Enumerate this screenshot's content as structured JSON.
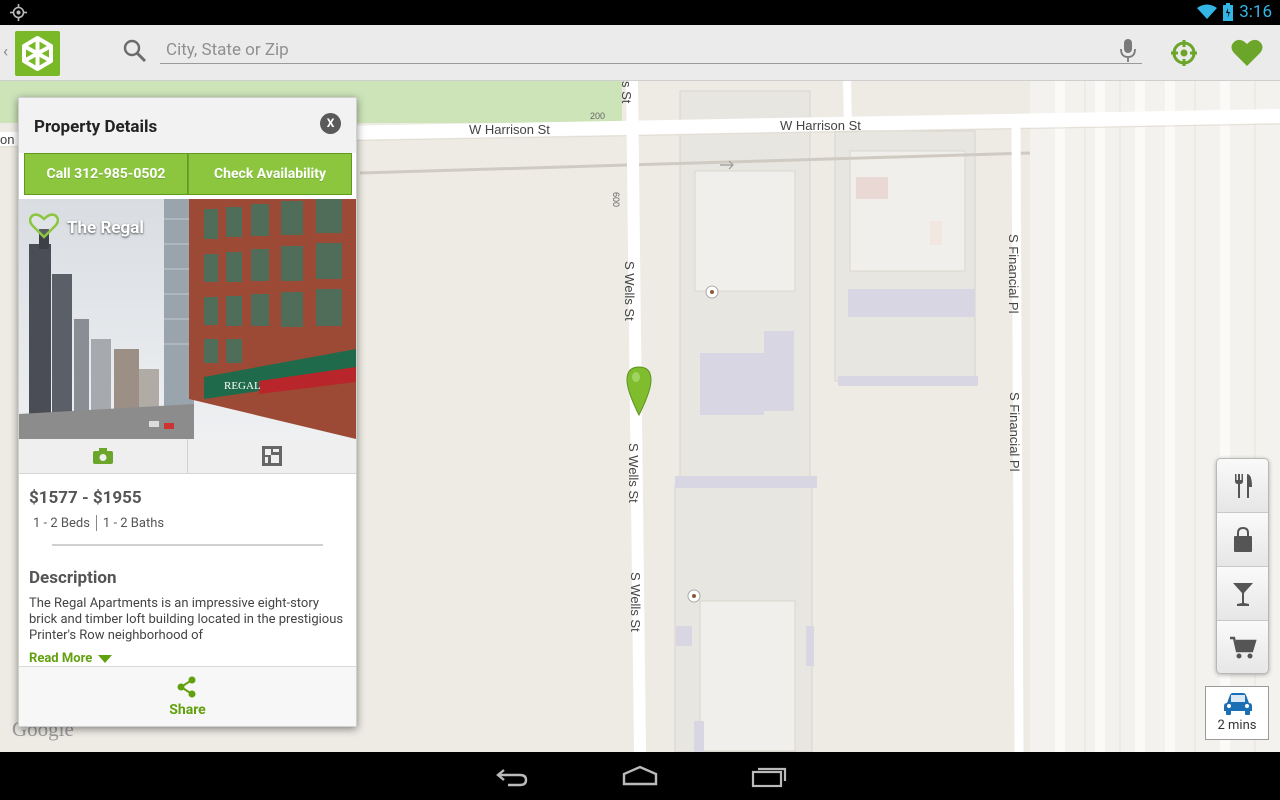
{
  "status_bar": {
    "time": "3:16"
  },
  "search": {
    "placeholder": "City, State or Zip",
    "value": ""
  },
  "map": {
    "streets": {
      "harrison_left": "W Harrison St",
      "harrison_right": "W Harrison St",
      "harrison_number": "200",
      "on_st": "on S",
      "wells_top": "s St",
      "wells_number": "600",
      "wells_1": "S Wells St",
      "wells_2": "S Wells St",
      "wells_3": "S Wells St",
      "financial_1": "S Financial Pl",
      "financial_2": "S Financial Pl"
    },
    "attribution": "Google"
  },
  "panel": {
    "title": "Property Details",
    "close_label": "X",
    "call_label": "Call 312-985-0502",
    "availability_label": "Check Availability",
    "property_name": "The Regal",
    "price": "$1577 - $1955",
    "beds": "1 - 2 Beds",
    "baths": "1 - 2 Baths",
    "description_heading": "Description",
    "description": "The Regal Apartments is an impressive eight-story brick and timber loft building located in the prestigious Printer's Row neighborhood of",
    "read_more": "Read More",
    "share_label": "Share"
  },
  "commute": {
    "label": "2 mins"
  },
  "colors": {
    "accent": "#79b928",
    "link": "#62a10e",
    "status_blue": "#33b5e5"
  }
}
